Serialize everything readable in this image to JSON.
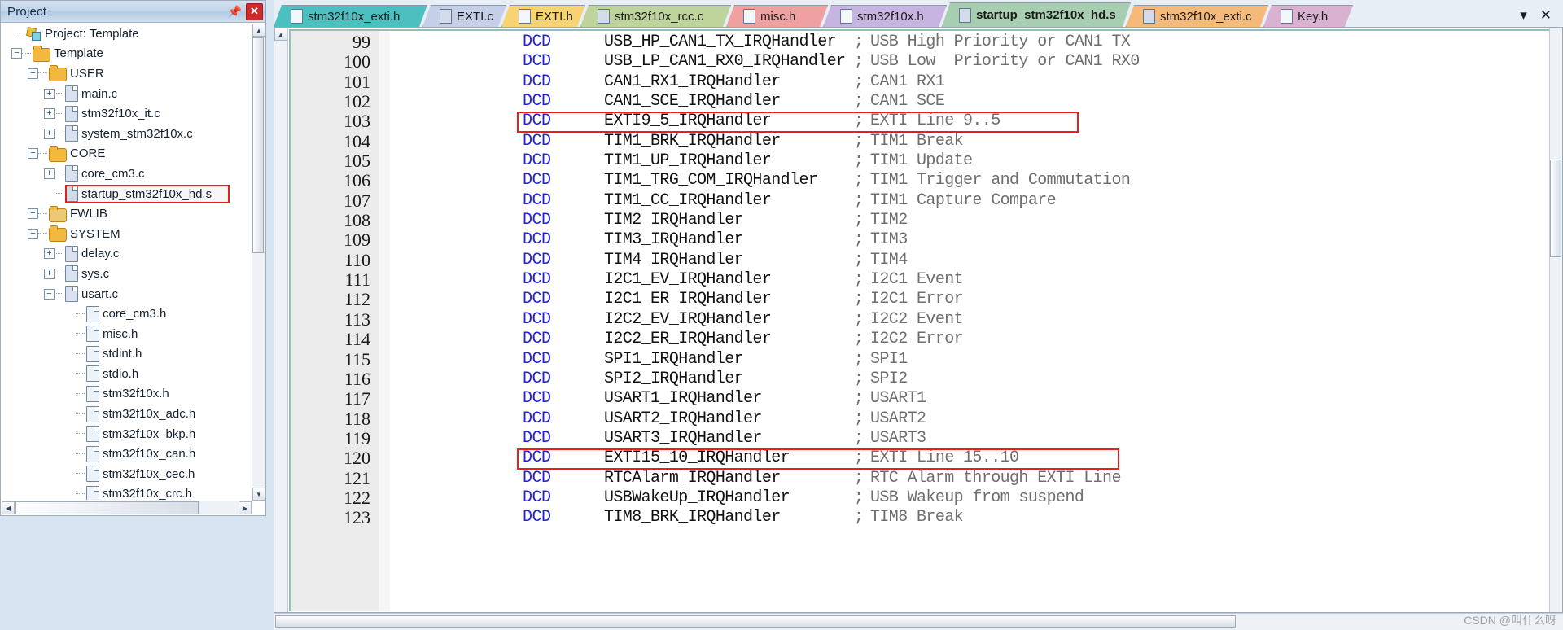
{
  "panel": {
    "title": "Project",
    "pin_icon": "pin-icon",
    "close_icon": "close-icon",
    "root_label": "Project: Template"
  },
  "tree": [
    {
      "depth": 0,
      "label": "Project: Template",
      "icon": "project-icon",
      "toggle": "none"
    },
    {
      "depth": 1,
      "label": "Template",
      "icon": "folder-open-icon",
      "toggle": "minus"
    },
    {
      "depth": 2,
      "label": "USER",
      "icon": "folder-open-icon",
      "toggle": "minus"
    },
    {
      "depth": 3,
      "label": "main.c",
      "icon": "c-file-icon",
      "toggle": "plus"
    },
    {
      "depth": 3,
      "label": "stm32f10x_it.c",
      "icon": "c-file-icon",
      "toggle": "plus"
    },
    {
      "depth": 3,
      "label": "system_stm32f10x.c",
      "icon": "c-file-icon",
      "toggle": "plus"
    },
    {
      "depth": 2,
      "label": "CORE",
      "icon": "folder-open-icon",
      "toggle": "minus"
    },
    {
      "depth": 3,
      "label": "core_cm3.c",
      "icon": "c-file-icon",
      "toggle": "plus"
    },
    {
      "depth": 3,
      "label": "startup_stm32f10x_hd.s",
      "icon": "asm-file-icon",
      "toggle": "none",
      "selected": true
    },
    {
      "depth": 2,
      "label": "FWLIB",
      "icon": "folder-closed-icon",
      "toggle": "plus"
    },
    {
      "depth": 2,
      "label": "SYSTEM",
      "icon": "folder-open-icon",
      "toggle": "minus"
    },
    {
      "depth": 3,
      "label": "delay.c",
      "icon": "c-file-icon",
      "toggle": "plus"
    },
    {
      "depth": 3,
      "label": "sys.c",
      "icon": "c-file-icon",
      "toggle": "plus"
    },
    {
      "depth": 3,
      "label": "usart.c",
      "icon": "c-file-icon",
      "toggle": "minus"
    },
    {
      "depth": 4,
      "label": "core_cm3.h",
      "icon": "h-file-icon",
      "toggle": "none"
    },
    {
      "depth": 4,
      "label": "misc.h",
      "icon": "h-file-icon",
      "toggle": "none"
    },
    {
      "depth": 4,
      "label": "stdint.h",
      "icon": "h-file-icon",
      "toggle": "none"
    },
    {
      "depth": 4,
      "label": "stdio.h",
      "icon": "h-file-icon",
      "toggle": "none"
    },
    {
      "depth": 4,
      "label": "stm32f10x.h",
      "icon": "h-file-icon",
      "toggle": "none"
    },
    {
      "depth": 4,
      "label": "stm32f10x_adc.h",
      "icon": "h-file-icon",
      "toggle": "none"
    },
    {
      "depth": 4,
      "label": "stm32f10x_bkp.h",
      "icon": "h-file-icon",
      "toggle": "none"
    },
    {
      "depth": 4,
      "label": "stm32f10x_can.h",
      "icon": "h-file-icon",
      "toggle": "none"
    },
    {
      "depth": 4,
      "label": "stm32f10x_cec.h",
      "icon": "h-file-icon",
      "toggle": "none"
    },
    {
      "depth": 4,
      "label": "stm32f10x_crc.h",
      "icon": "h-file-icon",
      "toggle": "none"
    }
  ],
  "tabs": [
    {
      "label": "stm32f10x_exti.h",
      "color": "#4cc0c0",
      "icon": "h-file-icon",
      "active": false
    },
    {
      "label": "EXTI.c",
      "color": "#c6cfe8",
      "icon": "c-file-icon",
      "active": false
    },
    {
      "label": "EXTI.h",
      "color": "#f7d372",
      "icon": "h-file-icon",
      "active": false
    },
    {
      "label": "stm32f10x_rcc.c",
      "color": "#bed49a",
      "icon": "c-file-icon",
      "active": false
    },
    {
      "label": "misc.h",
      "color": "#efa0a0",
      "icon": "h-file-icon",
      "active": false
    },
    {
      "label": "stm32f10x.h",
      "color": "#c8b4e0",
      "icon": "h-file-icon",
      "active": false
    },
    {
      "label": "startup_stm32f10x_hd.s",
      "color": "#a8ceb2",
      "icon": "asm-file-icon",
      "active": true
    },
    {
      "label": "stm32f10x_exti.c",
      "color": "#f5b97a",
      "icon": "c-file-icon",
      "active": false
    },
    {
      "label": "Key.h",
      "color": "#d9b2d2",
      "icon": "h-file-icon",
      "active": false
    }
  ],
  "tab_controls": {
    "overflow_icon": "chevron-down-icon",
    "close_icon": "close-icon"
  },
  "code": {
    "keyword": "DCD",
    "comment_marker": ";",
    "lines": [
      {
        "num": "99",
        "sym": "USB_HP_CAN1_TX_IRQHandler",
        "cmt": "USB High Priority or CAN1 TX"
      },
      {
        "num": "100",
        "sym": "USB_LP_CAN1_RX0_IRQHandler",
        "cmt": "USB Low  Priority or CAN1 RX0"
      },
      {
        "num": "101",
        "sym": "CAN1_RX1_IRQHandler",
        "cmt": "CAN1 RX1"
      },
      {
        "num": "102",
        "sym": "CAN1_SCE_IRQHandler",
        "cmt": "CAN1 SCE"
      },
      {
        "num": "103",
        "sym": "EXTI9_5_IRQHandler",
        "cmt": "EXTI Line 9..5",
        "highlight": true
      },
      {
        "num": "104",
        "sym": "TIM1_BRK_IRQHandler",
        "cmt": "TIM1 Break"
      },
      {
        "num": "105",
        "sym": "TIM1_UP_IRQHandler",
        "cmt": "TIM1 Update"
      },
      {
        "num": "106",
        "sym": "TIM1_TRG_COM_IRQHandler",
        "cmt": "TIM1 Trigger and Commutation"
      },
      {
        "num": "107",
        "sym": "TIM1_CC_IRQHandler",
        "cmt": "TIM1 Capture Compare"
      },
      {
        "num": "108",
        "sym": "TIM2_IRQHandler",
        "cmt": "TIM2"
      },
      {
        "num": "109",
        "sym": "TIM3_IRQHandler",
        "cmt": "TIM3"
      },
      {
        "num": "110",
        "sym": "TIM4_IRQHandler",
        "cmt": "TIM4"
      },
      {
        "num": "111",
        "sym": "I2C1_EV_IRQHandler",
        "cmt": "I2C1 Event"
      },
      {
        "num": "112",
        "sym": "I2C1_ER_IRQHandler",
        "cmt": "I2C1 Error"
      },
      {
        "num": "113",
        "sym": "I2C2_EV_IRQHandler",
        "cmt": "I2C2 Event"
      },
      {
        "num": "114",
        "sym": "I2C2_ER_IRQHandler",
        "cmt": "I2C2 Error"
      },
      {
        "num": "115",
        "sym": "SPI1_IRQHandler",
        "cmt": "SPI1"
      },
      {
        "num": "116",
        "sym": "SPI2_IRQHandler",
        "cmt": "SPI2"
      },
      {
        "num": "117",
        "sym": "USART1_IRQHandler",
        "cmt": "USART1"
      },
      {
        "num": "118",
        "sym": "USART2_IRQHandler",
        "cmt": "USART2"
      },
      {
        "num": "119",
        "sym": "USART3_IRQHandler",
        "cmt": "USART3"
      },
      {
        "num": "120",
        "sym": "EXTI15_10_IRQHandler",
        "cmt": "EXTI Line 15..10",
        "highlight": true
      },
      {
        "num": "121",
        "sym": "RTCAlarm_IRQHandler",
        "cmt": "RTC Alarm through EXTI Line"
      },
      {
        "num": "122",
        "sym": "USBWakeUp_IRQHandler",
        "cmt": "USB Wakeup from suspend"
      },
      {
        "num": "123",
        "sym": "TIM8_BRK_IRQHandler",
        "cmt": "TIM8 Break"
      }
    ]
  },
  "watermark": "CSDN @叫什么呀",
  "colors": {
    "highlight": "#ef1b1b",
    "keyword": "#2222e0",
    "comment": "#6e6e6e",
    "active_tab": "#a8ceb2"
  }
}
